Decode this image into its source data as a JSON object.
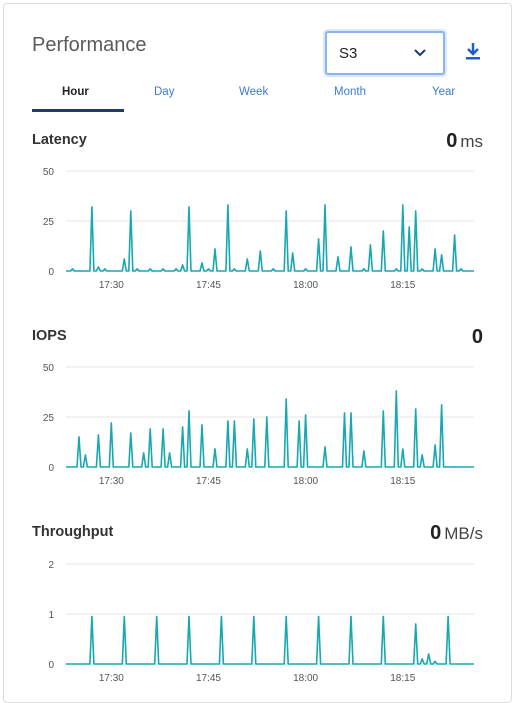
{
  "header": {
    "title": "Performance",
    "select_value": "S3",
    "download_icon": "download-icon",
    "chevron_icon": "chevron-down-icon"
  },
  "tabs": [
    {
      "label": "Hour",
      "active": true
    },
    {
      "label": "Day",
      "active": false
    },
    {
      "label": "Week",
      "active": false
    },
    {
      "label": "Month",
      "active": false
    },
    {
      "label": "Year",
      "active": false
    }
  ],
  "colors": {
    "series": "#17a8b2",
    "grid": "#e6e6e6",
    "accent": "#3b7bd4",
    "tab_underline": "#1f3a6e"
  },
  "latency": {
    "title": "Latency",
    "value": "0",
    "unit": "ms"
  },
  "iops": {
    "title": "IOPS",
    "value": "0",
    "unit": ""
  },
  "throughput": {
    "title": "Throughput",
    "value": "0",
    "unit": "MB/s"
  },
  "chart_data": [
    {
      "type": "line",
      "title": "Latency",
      "ylim": [
        0,
        50
      ],
      "yticks": [
        "50",
        "25",
        "0"
      ],
      "xticks": [
        "17:30",
        "17:45",
        "18:00",
        "18:15"
      ],
      "grid": true,
      "x": [
        "17:24",
        "17:26",
        "17:27",
        "17:28",
        "17:29",
        "17:32",
        "17:33",
        "17:34",
        "17:36",
        "17:38",
        "17:40",
        "17:41",
        "17:42",
        "17:44",
        "17:45",
        "17:46",
        "17:48",
        "17:49",
        "17:51",
        "17:53",
        "17:55",
        "17:57",
        "17:58",
        "18:00",
        "18:02",
        "18:03",
        "18:05",
        "18:07",
        "18:09",
        "18:10",
        "18:12",
        "18:14",
        "18:15",
        "18:16",
        "18:17",
        "18:18",
        "18:20",
        "18:21",
        "18:23",
        "18:24"
      ],
      "values": [
        1,
        0,
        32,
        2,
        1,
        6,
        30,
        1,
        1,
        1,
        1,
        3,
        32,
        4,
        1,
        11,
        33,
        1,
        6,
        10,
        1,
        30,
        9,
        1,
        16,
        33,
        7,
        12,
        1,
        13,
        20,
        1,
        33,
        22,
        30,
        1,
        11,
        8,
        18,
        1
      ]
    },
    {
      "type": "line",
      "title": "IOPS",
      "ylim": [
        0,
        50
      ],
      "yticks": [
        "50",
        "25",
        "0"
      ],
      "xticks": [
        "17:30",
        "17:45",
        "18:00",
        "18:15"
      ],
      "grid": true,
      "x": [
        "17:25",
        "17:26",
        "17:28",
        "17:30",
        "17:33",
        "17:35",
        "17:36",
        "17:38",
        "17:39",
        "17:41",
        "17:42",
        "17:44",
        "17:46",
        "17:48",
        "17:49",
        "17:51",
        "17:52",
        "17:54",
        "17:57",
        "17:59",
        "18:00",
        "18:03",
        "18:06",
        "18:07",
        "18:09",
        "18:12",
        "18:14",
        "18:15",
        "18:17",
        "18:18",
        "18:20",
        "18:21",
        "18:23"
      ],
      "values": [
        15,
        6,
        16,
        22,
        17,
        7,
        19,
        19,
        7,
        20,
        28,
        21,
        9,
        23,
        23,
        9,
        24,
        25,
        34,
        23,
        26,
        10,
        27,
        27,
        8,
        28,
        38,
        9,
        29,
        6,
        11,
        31,
        0
      ]
    },
    {
      "type": "line",
      "title": "Throughput",
      "ylim": [
        0,
        2
      ],
      "yticks": [
        "2",
        "1",
        "0"
      ],
      "xticks": [
        "17:30",
        "17:45",
        "18:00",
        "18:15"
      ],
      "grid": true,
      "x": [
        "17:27",
        "17:32",
        "17:37",
        "17:42",
        "17:47",
        "17:52",
        "17:57",
        "18:02",
        "18:07",
        "18:12",
        "18:17",
        "18:18",
        "18:19",
        "18:20",
        "18:22"
      ],
      "values": [
        0.95,
        0.95,
        0.95,
        0.95,
        0.95,
        0.95,
        0.95,
        0.95,
        0.95,
        0.95,
        0.8,
        0.1,
        0.2,
        0.05,
        0.95
      ]
    }
  ]
}
